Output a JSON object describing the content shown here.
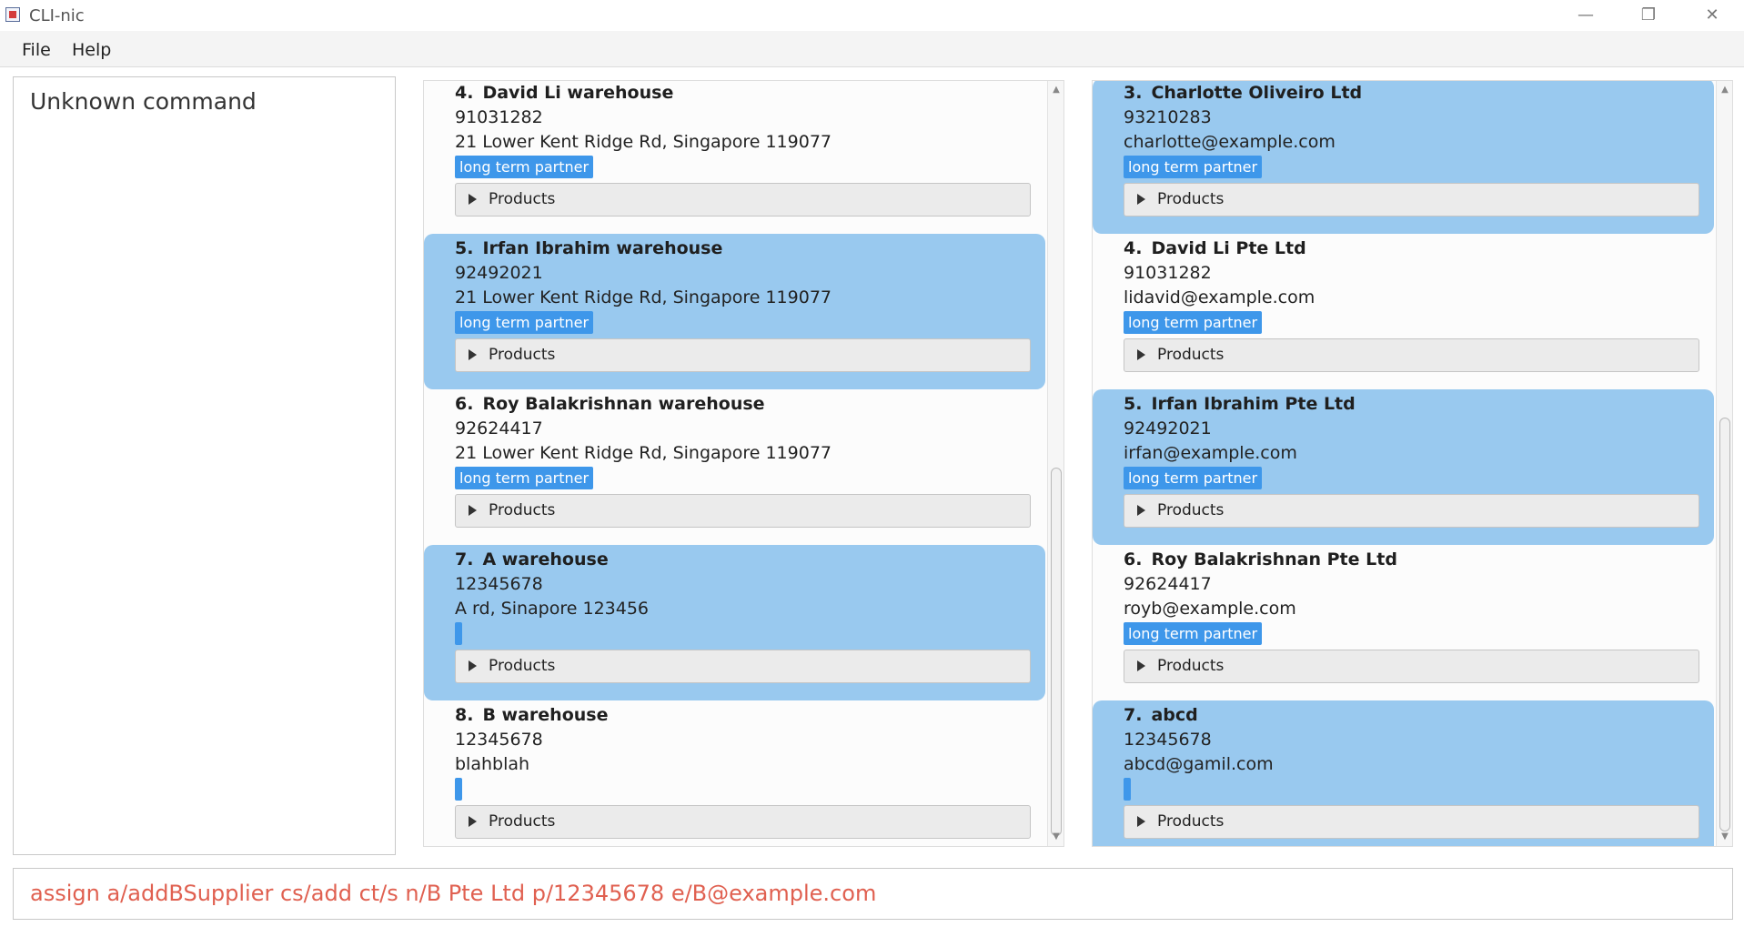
{
  "window": {
    "title": "CLI-nic",
    "minimize_glyph": "—",
    "restore_glyph": "❐",
    "close_glyph": "✕"
  },
  "menu": {
    "file": "File",
    "help": "Help"
  },
  "result": {
    "text": "Unknown command"
  },
  "warehouses": [
    {
      "index": "4.",
      "name": "David Li warehouse",
      "phone": "91031282",
      "address": "21 Lower Kent Ridge Rd, Singapore 119077",
      "tag": "long term partner",
      "products_label": "Products",
      "selected": false
    },
    {
      "index": "5.",
      "name": "Irfan Ibrahim warehouse",
      "phone": "92492021",
      "address": "21 Lower Kent Ridge Rd, Singapore 119077",
      "tag": "long term partner",
      "products_label": "Products",
      "selected": true
    },
    {
      "index": "6.",
      "name": "Roy Balakrishnan warehouse",
      "phone": "92624417",
      "address": "21 Lower Kent Ridge Rd, Singapore 119077",
      "tag": "long term partner",
      "products_label": "Products",
      "selected": false
    },
    {
      "index": "7.",
      "name": "A warehouse",
      "phone": "12345678",
      "address": "A rd, Sinapore 123456",
      "tag": "",
      "products_label": "Products",
      "selected": true
    },
    {
      "index": "8.",
      "name": "B warehouse",
      "phone": "12345678",
      "address": "blahblah",
      "tag": "",
      "products_label": "Products",
      "selected": false
    }
  ],
  "suppliers": [
    {
      "index": "3.",
      "name": "Charlotte Oliveiro Ltd",
      "phone": "93210283",
      "email": "charlotte@example.com",
      "tag": "long term partner",
      "products_label": "Products",
      "selected": true
    },
    {
      "index": "4.",
      "name": "David Li Pte Ltd",
      "phone": "91031282",
      "email": "lidavid@example.com",
      "tag": "long term partner",
      "products_label": "Products",
      "selected": false
    },
    {
      "index": "5.",
      "name": "Irfan Ibrahim Pte Ltd",
      "phone": "92492021",
      "email": "irfan@example.com",
      "tag": "long term partner",
      "products_label": "Products",
      "selected": true
    },
    {
      "index": "6.",
      "name": "Roy Balakrishnan Pte Ltd",
      "phone": "92624417",
      "email": "royb@example.com",
      "tag": "long term partner",
      "products_label": "Products",
      "selected": false
    },
    {
      "index": "7.",
      "name": "abcd",
      "phone": "12345678",
      "email": "abcd@gamil.com",
      "tag": "",
      "products_label": "Products",
      "selected": true
    }
  ],
  "command": {
    "text": "assign a/addBSupplier cs/add ct/s n/B Pte Ltd p/12345678 e/B@example.com"
  },
  "colors": {
    "selected_cell": "#99c9ef",
    "tag": "#3e97ea",
    "command_text": "#e06050"
  }
}
